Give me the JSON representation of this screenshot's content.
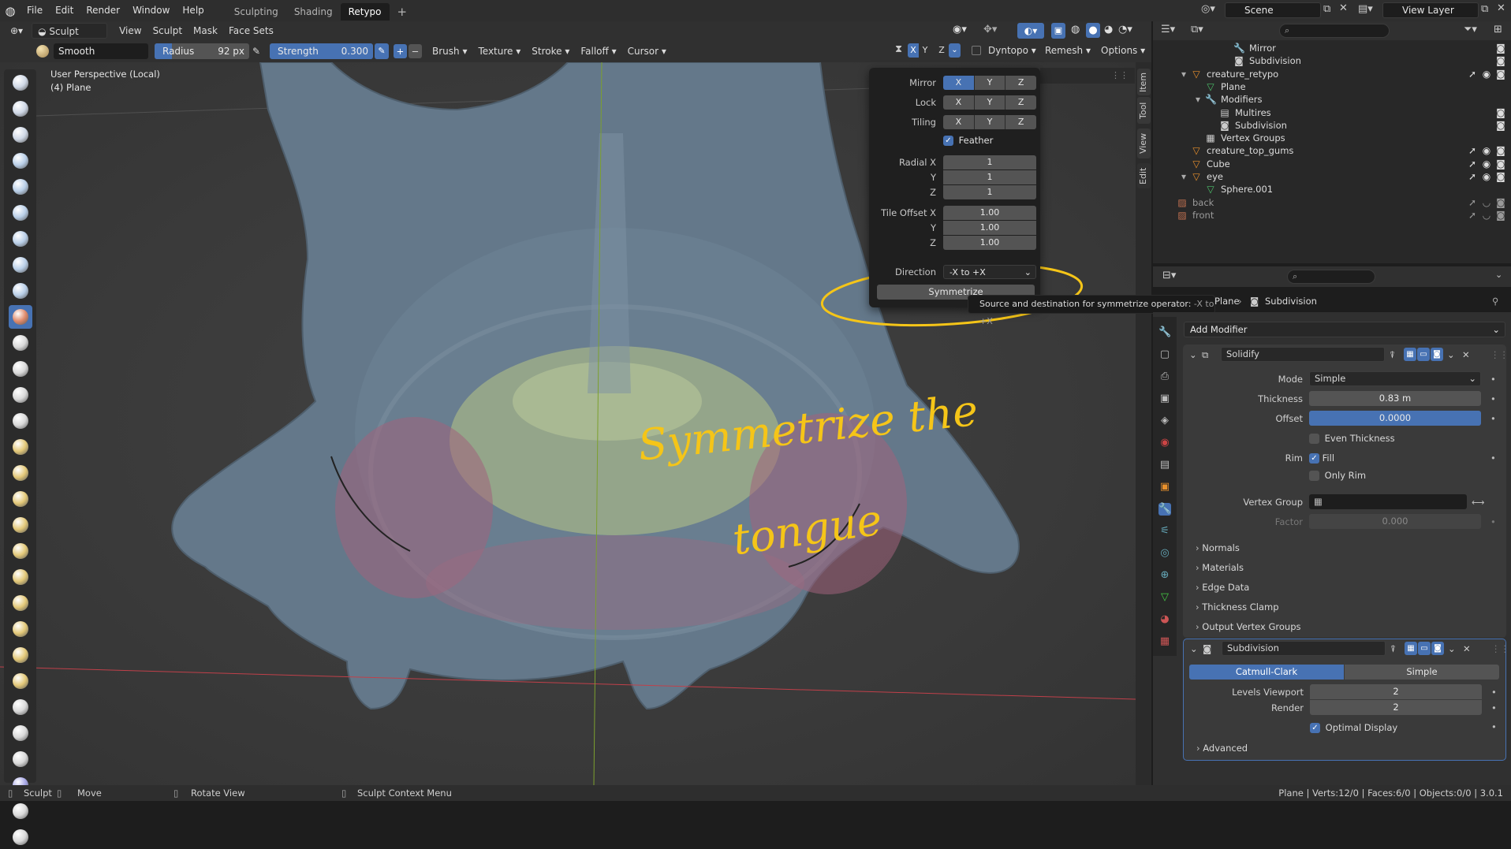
{
  "menu": {
    "file": "File",
    "edit": "Edit",
    "render": "Render",
    "window": "Window",
    "help": "Help"
  },
  "workspaces": [
    "Sculpting",
    "Shading",
    "Retypo"
  ],
  "workspace_add": "+",
  "scene": {
    "name": "Scene",
    "view_layer": "View Layer"
  },
  "header": {
    "mode": "Sculpt Mode",
    "view": "View",
    "sculpt": "Sculpt",
    "mask": "Mask",
    "face_sets": "Face Sets"
  },
  "tool_settings": {
    "brush_name": "Smooth",
    "radius_label": "Radius",
    "radius_value": "92 px",
    "strength_label": "Strength",
    "strength_value": "0.300",
    "plus": "+",
    "minus": "−",
    "brush": "Brush",
    "texture": "Texture",
    "stroke": "Stroke",
    "falloff": "Falloff",
    "cursor": "Cursor",
    "sym_x": "X",
    "sym_y": "Y",
    "sym_z": "Z",
    "dyntopo": "Dyntopo",
    "remesh": "Remesh",
    "options": "Options"
  },
  "viewport": {
    "perspective": "User Perspective (Local)",
    "object": "(4) Plane",
    "annotation_line1": "Symmetrize the",
    "annotation_line2": "tongue"
  },
  "sidetabs": [
    "Item",
    "Tool",
    "View",
    "Edit"
  ],
  "symmetry_popover": {
    "mirror_label": "Mirror",
    "lock_label": "Lock",
    "tiling_label": "Tiling",
    "x": "X",
    "y": "Y",
    "z": "Z",
    "feather_label": "Feather",
    "feather_checked": true,
    "radial_x_label": "Radial X",
    "radial_y_label": "Y",
    "radial_z_label": "Z",
    "radial_x": "1",
    "radial_y": "1",
    "radial_z": "1",
    "tile_offset_x_label": "Tile Offset X",
    "tile_offset_y_label": "Y",
    "tile_offset_z_label": "Z",
    "tile_offset_x": "1.00",
    "tile_offset_y": "1.00",
    "tile_offset_z": "1.00",
    "direction_label": "Direction",
    "direction_value": "-X to +X",
    "symmetrize_button": "Symmetrize"
  },
  "tooltip": {
    "text": "Source and destination for symmetrize operator:",
    "value": "-X to +X"
  },
  "outliner": {
    "search_placeholder": "",
    "rows": [
      {
        "label": "Mirror",
        "depth": 5,
        "icon": "wrench"
      },
      {
        "label": "Subdivision",
        "depth": 5,
        "icon": "subdiv"
      },
      {
        "label": "creature_retypo",
        "depth": 2,
        "icon": "mesh",
        "expanded": true
      },
      {
        "label": "Plane",
        "depth": 3,
        "icon": "meshdata"
      },
      {
        "label": "Modifiers",
        "depth": 3,
        "icon": "wrench",
        "expanded": true
      },
      {
        "label": "Multires",
        "depth": 4,
        "icon": "multires"
      },
      {
        "label": "Subdivision",
        "depth": 4,
        "icon": "subdiv"
      },
      {
        "label": "Vertex Groups",
        "depth": 3,
        "icon": "vgroup"
      },
      {
        "label": "creature_top_gums",
        "depth": 2,
        "icon": "mesh"
      },
      {
        "label": "Cube",
        "depth": 2,
        "icon": "mesh"
      },
      {
        "label": "eye",
        "depth": 2,
        "icon": "mesh",
        "expanded": true
      },
      {
        "label": "Sphere.001",
        "depth": 3,
        "icon": "meshdata"
      },
      {
        "label": "back",
        "depth": 1,
        "icon": "image",
        "dim": true
      },
      {
        "label": "front",
        "depth": 1,
        "icon": "image",
        "dim": true
      }
    ]
  },
  "properties": {
    "breadcrumb_object": "Plane",
    "breadcrumb_modifier": "Subdivision",
    "add_modifier": "Add Modifier",
    "solidify": {
      "name": "Solidify",
      "mode_label": "Mode",
      "mode_value": "Simple",
      "thickness_label": "Thickness",
      "thickness_value": "0.83 m",
      "offset_label": "Offset",
      "offset_value": "0.0000",
      "even_thickness": "Even Thickness",
      "rim_label": "Rim",
      "fill": "Fill",
      "only_rim": "Only Rim",
      "vertex_group_label": "Vertex Group",
      "factor_label": "Factor",
      "factor_value": "0.000",
      "normals": "Normals",
      "materials": "Materials",
      "edge_data": "Edge Data",
      "thickness_clamp": "Thickness Clamp",
      "output_vertex_groups": "Output Vertex Groups"
    },
    "subdivision": {
      "name": "Subdivision",
      "catmull": "Catmull-Clark",
      "simple": "Simple",
      "levels_viewport_label": "Levels Viewport",
      "levels_viewport": "2",
      "render_label": "Render",
      "render_value": "2",
      "optimal_display": "Optimal Display",
      "advanced": "Advanced"
    }
  },
  "statusbar": {
    "sculpt": "Sculpt",
    "move": "Move",
    "rotate": "Rotate View",
    "context": "Sculpt Context Menu",
    "stats": "Plane | Verts:12/0 | Faces:6/0 | Objects:0/0 | 3.0.1"
  },
  "colors": {
    "accent": "#4772b3",
    "annotation": "#f5c518",
    "axis_x": "#c0404a",
    "axis_y": "#7ca02e"
  }
}
